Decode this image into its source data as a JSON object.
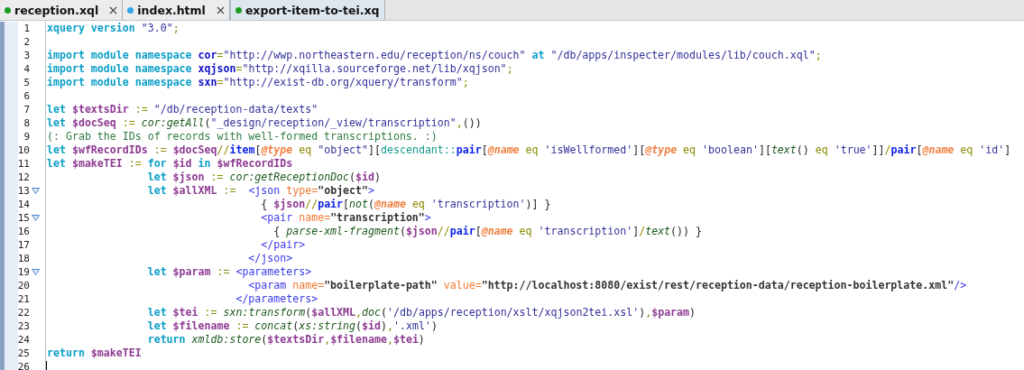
{
  "tabs": [
    {
      "label": "reception.xql",
      "color": "#1e9e1e",
      "selected": false,
      "closable": true
    },
    {
      "label": "index.html",
      "color": "#2aa6e8",
      "selected": false,
      "closable": true
    },
    {
      "label": "export-item-to-tei.xq",
      "color": "#1e9e1e",
      "selected": true,
      "closable": false
    }
  ],
  "editor": {
    "lines": [
      {
        "number": "1",
        "fold": false,
        "cursor": false,
        "tokens": [
          {
            "kind": "kw",
            "text": "xquery"
          },
          {
            "kind": "kw",
            "text": " version"
          },
          {
            "kind": "str",
            "text": " \"3.0\""
          },
          {
            "kind": "op",
            "text": ";"
          }
        ]
      },
      {
        "number": "2",
        "fold": false,
        "cursor": false
      },
      {
        "number": "3",
        "fold": false,
        "cursor": false,
        "tokens": [
          {
            "kind": "kw",
            "text": "import"
          },
          {
            "kind": "kw",
            "text": " module"
          },
          {
            "kind": "kw",
            "text": " namespace"
          },
          {
            "kind": "ns",
            "text": " cor"
          },
          {
            "kind": "op",
            "text": "="
          },
          {
            "kind": "str",
            "text": "\"http://wwp.northeastern.edu/reception/ns/couch\""
          },
          {
            "kind": "kw",
            "text": " at"
          },
          {
            "kind": "str",
            "text": " \"/db/apps/inspecter/modules/lib/couch.xql\""
          },
          {
            "kind": "op",
            "text": ";"
          }
        ]
      },
      {
        "number": "4",
        "fold": false,
        "cursor": false,
        "tokens": [
          {
            "kind": "kw",
            "text": "import"
          },
          {
            "kind": "kw",
            "text": " module"
          },
          {
            "kind": "kw",
            "text": " namespace"
          },
          {
            "kind": "ns",
            "text": " xqjson"
          },
          {
            "kind": "op",
            "text": "="
          },
          {
            "kind": "str",
            "text": "\"http://xqilla.sourceforge.net/lib/xqjson\""
          },
          {
            "kind": "op",
            "text": ";"
          }
        ]
      },
      {
        "number": "5",
        "fold": false,
        "cursor": false,
        "tokens": [
          {
            "kind": "kw",
            "text": "import"
          },
          {
            "kind": "kw",
            "text": " module"
          },
          {
            "kind": "kw",
            "text": " namespace"
          },
          {
            "kind": "ns",
            "text": " sxn"
          },
          {
            "kind": "op",
            "text": "="
          },
          {
            "kind": "str",
            "text": "\"http://exist-db.org/xquery/transform\""
          },
          {
            "kind": "op",
            "text": ";"
          }
        ]
      },
      {
        "number": "6",
        "fold": false,
        "cursor": false
      },
      {
        "number": "7",
        "fold": false,
        "cursor": false,
        "tokens": [
          {
            "kind": "kw",
            "text": "let"
          },
          {
            "kind": "var",
            "text": " $textsDir"
          },
          {
            "kind": "op",
            "text": " :="
          },
          {
            "kind": "str",
            "text": " \"/db/reception-data/texts\""
          }
        ]
      },
      {
        "number": "8",
        "fold": false,
        "cursor": false,
        "tokens": [
          {
            "kind": "kw",
            "text": "let"
          },
          {
            "kind": "var",
            "text": " $docSeq"
          },
          {
            "kind": "op",
            "text": " :="
          },
          {
            "kind": "fn",
            "text": " cor:getAll"
          },
          {
            "kind": "plain",
            "text": "("
          },
          {
            "kind": "str",
            "text": "\"_design/reception/_view/transcription\""
          },
          {
            "kind": "op",
            "text": ","
          },
          {
            "kind": "plain",
            "text": "())"
          }
        ]
      },
      {
        "number": "9",
        "fold": false,
        "cursor": false,
        "tokens": [
          {
            "kind": "comment",
            "text": "(: Grab the IDs of records with well-formed transcriptions. :)"
          }
        ]
      },
      {
        "number": "10",
        "fold": false,
        "cursor": false,
        "tokens": [
          {
            "kind": "kw",
            "text": "let"
          },
          {
            "kind": "var",
            "text": " $wfRecordIDs"
          },
          {
            "kind": "op",
            "text": " :="
          },
          {
            "kind": "var",
            "text": " $docSeq"
          },
          {
            "kind": "op",
            "text": "//"
          },
          {
            "kind": "axis",
            "text": "item"
          },
          {
            "kind": "plain",
            "text": "["
          },
          {
            "kind": "attr",
            "text": "@type"
          },
          {
            "kind": "op",
            "text": " eq"
          },
          {
            "kind": "str",
            "text": " \"object\""
          },
          {
            "kind": "plain",
            "text": "]["
          },
          {
            "kind": "step",
            "text": "descendant::"
          },
          {
            "kind": "axis",
            "text": "pair"
          },
          {
            "kind": "plain",
            "text": "["
          },
          {
            "kind": "attr",
            "text": "@name"
          },
          {
            "kind": "op",
            "text": " eq"
          },
          {
            "kind": "str",
            "text": " 'isWellformed'"
          },
          {
            "kind": "plain",
            "text": "]["
          },
          {
            "kind": "attr",
            "text": "@type"
          },
          {
            "kind": "op",
            "text": " eq"
          },
          {
            "kind": "str",
            "text": " 'boolean'"
          },
          {
            "kind": "plain",
            "text": "]["
          },
          {
            "kind": "fn",
            "text": "text"
          },
          {
            "kind": "plain",
            "text": "()"
          },
          {
            "kind": "op",
            "text": " eq"
          },
          {
            "kind": "str",
            "text": " 'true'"
          },
          {
            "kind": "plain",
            "text": "]]"
          },
          {
            "kind": "op",
            "text": "/"
          },
          {
            "kind": "axis",
            "text": "pair"
          },
          {
            "kind": "plain",
            "text": "["
          },
          {
            "kind": "attr",
            "text": "@name"
          },
          {
            "kind": "op",
            "text": " eq"
          },
          {
            "kind": "str",
            "text": " 'id'"
          },
          {
            "kind": "plain",
            "text": "]"
          }
        ]
      },
      {
        "number": "11",
        "fold": false,
        "cursor": false,
        "tokens": [
          {
            "kind": "kw",
            "text": "let"
          },
          {
            "kind": "var",
            "text": " $makeTEI"
          },
          {
            "kind": "op",
            "text": " :="
          },
          {
            "kind": "kw",
            "text": " for"
          },
          {
            "kind": "var",
            "text": " $id"
          },
          {
            "kind": "kw",
            "text": " in"
          },
          {
            "kind": "var",
            "text": " $wfRecordIDs"
          }
        ]
      },
      {
        "number": "12",
        "fold": false,
        "cursor": false,
        "tokens": [
          {
            "kind": "kw",
            "text": "                let"
          },
          {
            "kind": "var",
            "text": " $json"
          },
          {
            "kind": "op",
            "text": " :="
          },
          {
            "kind": "fn",
            "text": " cor:getReceptionDoc"
          },
          {
            "kind": "plain",
            "text": "("
          },
          {
            "kind": "var",
            "text": "$id"
          },
          {
            "kind": "plain",
            "text": ")"
          }
        ]
      },
      {
        "number": "13",
        "fold": true,
        "cursor": false,
        "tokens": [
          {
            "kind": "kw",
            "text": "                let"
          },
          {
            "kind": "var",
            "text": " $allXML"
          },
          {
            "kind": "op",
            "text": " :="
          },
          {
            "kind": "tag",
            "text": "  <json"
          },
          {
            "kind": "xattr",
            "text": " type="
          },
          {
            "kind": "xval",
            "text": "\"object\""
          },
          {
            "kind": "tag",
            "text": ">"
          }
        ]
      },
      {
        "number": "14",
        "fold": false,
        "cursor": false,
        "tokens": [
          {
            "kind": "plain",
            "text": "                                  { "
          },
          {
            "kind": "var",
            "text": "$json"
          },
          {
            "kind": "op",
            "text": "//"
          },
          {
            "kind": "axis",
            "text": "pair"
          },
          {
            "kind": "plain",
            "text": "["
          },
          {
            "kind": "fn",
            "text": "not"
          },
          {
            "kind": "plain",
            "text": "("
          },
          {
            "kind": "attr",
            "text": "@name"
          },
          {
            "kind": "op",
            "text": " eq"
          },
          {
            "kind": "str",
            "text": " 'transcription'"
          },
          {
            "kind": "plain",
            "text": ")] }"
          }
        ]
      },
      {
        "number": "15",
        "fold": true,
        "cursor": false,
        "tokens": [
          {
            "kind": "tag",
            "text": "                                  <pair"
          },
          {
            "kind": "xattr",
            "text": " name="
          },
          {
            "kind": "xval",
            "text": "\"transcription\""
          },
          {
            "kind": "tag",
            "text": ">"
          }
        ]
      },
      {
        "number": "16",
        "fold": false,
        "cursor": false,
        "tokens": [
          {
            "kind": "plain",
            "text": "                                    { "
          },
          {
            "kind": "fn",
            "text": "parse-xml-fragment"
          },
          {
            "kind": "plain",
            "text": "("
          },
          {
            "kind": "var",
            "text": "$json"
          },
          {
            "kind": "op",
            "text": "//"
          },
          {
            "kind": "axis",
            "text": "pair"
          },
          {
            "kind": "plain",
            "text": "["
          },
          {
            "kind": "attr",
            "text": "@name"
          },
          {
            "kind": "op",
            "text": " eq"
          },
          {
            "kind": "str",
            "text": " 'transcription'"
          },
          {
            "kind": "plain",
            "text": "]"
          },
          {
            "kind": "op",
            "text": "/"
          },
          {
            "kind": "fn",
            "text": "text"
          },
          {
            "kind": "plain",
            "text": "()) }"
          }
        ]
      },
      {
        "number": "17",
        "fold": false,
        "cursor": false,
        "tokens": [
          {
            "kind": "tag",
            "text": "                                  </pair>"
          }
        ]
      },
      {
        "number": "18",
        "fold": false,
        "cursor": false,
        "tokens": [
          {
            "kind": "tag",
            "text": "                                </json>"
          }
        ]
      },
      {
        "number": "19",
        "fold": true,
        "cursor": false,
        "tokens": [
          {
            "kind": "kw",
            "text": "                let"
          },
          {
            "kind": "var",
            "text": " $param"
          },
          {
            "kind": "op",
            "text": " :="
          },
          {
            "kind": "tag",
            "text": " <parameters>"
          }
        ]
      },
      {
        "number": "20",
        "fold": false,
        "cursor": false,
        "tokens": [
          {
            "kind": "tag",
            "text": "                                <param"
          },
          {
            "kind": "xattr",
            "text": " name="
          },
          {
            "kind": "xval",
            "text": "\"boilerplate-path\""
          },
          {
            "kind": "xattr",
            "text": " value="
          },
          {
            "kind": "xval",
            "text": "\"http://localhost:8080/exist/rest/reception-data/reception-boilerplate.xml\""
          },
          {
            "kind": "tag",
            "text": "/>"
          }
        ]
      },
      {
        "number": "21",
        "fold": false,
        "cursor": false,
        "tokens": [
          {
            "kind": "tag",
            "text": "                              </parameters>"
          }
        ]
      },
      {
        "number": "22",
        "fold": false,
        "cursor": false,
        "tokens": [
          {
            "kind": "kw",
            "text": "                let"
          },
          {
            "kind": "var",
            "text": " $tei"
          },
          {
            "kind": "op",
            "text": " :="
          },
          {
            "kind": "fn",
            "text": " sxn:transform"
          },
          {
            "kind": "plain",
            "text": "("
          },
          {
            "kind": "var",
            "text": "$allXML"
          },
          {
            "kind": "op",
            "text": ","
          },
          {
            "kind": "fn",
            "text": "doc"
          },
          {
            "kind": "plain",
            "text": "("
          },
          {
            "kind": "str",
            "text": "'/db/apps/reception/xslt/xqjson2tei.xsl'"
          },
          {
            "kind": "plain",
            "text": ")"
          },
          {
            "kind": "op",
            "text": ","
          },
          {
            "kind": "var",
            "text": "$param"
          },
          {
            "kind": "plain",
            "text": ")"
          }
        ]
      },
      {
        "number": "23",
        "fold": false,
        "cursor": false,
        "tokens": [
          {
            "kind": "kw",
            "text": "                let"
          },
          {
            "kind": "var",
            "text": " $filename"
          },
          {
            "kind": "op",
            "text": " :="
          },
          {
            "kind": "fn",
            "text": " concat"
          },
          {
            "kind": "plain",
            "text": "("
          },
          {
            "kind": "fn",
            "text": "xs:string"
          },
          {
            "kind": "plain",
            "text": "("
          },
          {
            "kind": "var",
            "text": "$id"
          },
          {
            "kind": "plain",
            "text": ")"
          },
          {
            "kind": "op",
            "text": ","
          },
          {
            "kind": "str",
            "text": "'.xml'"
          },
          {
            "kind": "plain",
            "text": ")"
          }
        ]
      },
      {
        "number": "24",
        "fold": false,
        "cursor": false,
        "tokens": [
          {
            "kind": "kw",
            "text": "                return"
          },
          {
            "kind": "fn",
            "text": " xmldb:store"
          },
          {
            "kind": "plain",
            "text": "("
          },
          {
            "kind": "var",
            "text": "$textsDir"
          },
          {
            "kind": "op",
            "text": ","
          },
          {
            "kind": "var",
            "text": "$filename"
          },
          {
            "kind": "op",
            "text": ","
          },
          {
            "kind": "var",
            "text": "$tei"
          },
          {
            "kind": "plain",
            "text": ")"
          }
        ]
      },
      {
        "number": "25",
        "fold": false,
        "cursor": false,
        "tokens": [
          {
            "kind": "kw",
            "text": "return"
          },
          {
            "kind": "var",
            "text": " $makeTEI"
          }
        ]
      },
      {
        "number": "26",
        "fold": false,
        "cursor": true
      }
    ]
  }
}
